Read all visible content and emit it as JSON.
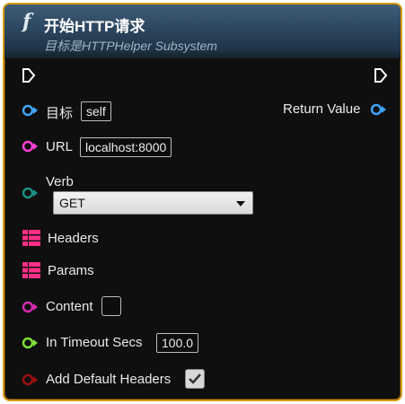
{
  "node": {
    "title": "开始HTTP请求",
    "subtitle": "目标是HTTPHelper Subsystem",
    "function_icon": "f",
    "accent_color": "#d79b12"
  },
  "pins": {
    "target": {
      "label": "目标",
      "value": "self",
      "color": "#3ea6ff"
    },
    "url": {
      "label": "URL",
      "value": "localhost:8000",
      "color": "#ff3fd6"
    },
    "verb": {
      "label": "Verb",
      "value": "GET",
      "color": "#1b8f84"
    },
    "headers": {
      "label": "Headers",
      "color": "#ff2f86"
    },
    "params": {
      "label": "Params",
      "color": "#ff2f86"
    },
    "content": {
      "label": "Content",
      "color": "#d42bb2",
      "checked": false
    },
    "timeout": {
      "label": "In Timeout Secs",
      "value": "100.0",
      "color": "#7ee03b"
    },
    "add_default_headers": {
      "label": "Add Default Headers",
      "color": "#9a1010",
      "checked": true
    },
    "return_value": {
      "label": "Return Value",
      "color": "#3ea6ff"
    }
  },
  "icons": {
    "exec_in": "exec-pin-icon",
    "exec_out": "exec-pin-icon",
    "headers": "map-grid-icon",
    "params": "map-grid-icon",
    "checkmark": "checkmark-icon",
    "dropdown": "chevron-down-icon"
  }
}
